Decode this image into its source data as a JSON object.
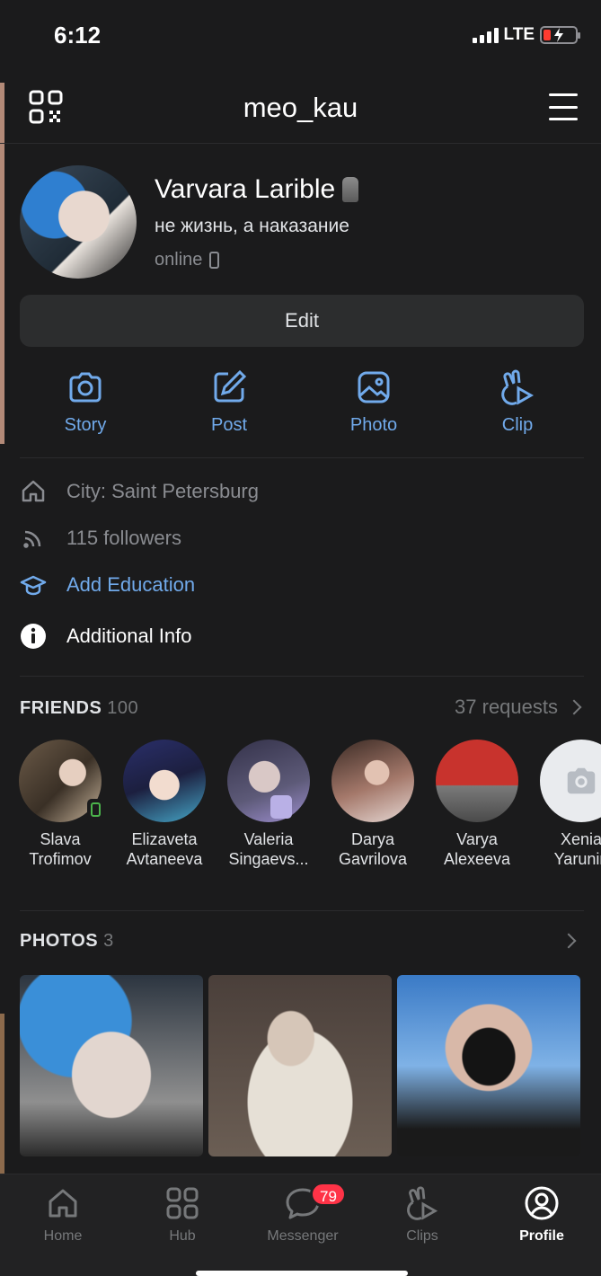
{
  "status_bar": {
    "time": "6:12",
    "network": "LTE"
  },
  "header": {
    "title": "meo_kau"
  },
  "profile": {
    "name": "Varvara Larible",
    "status": "не жизнь, а наказание",
    "online": "online",
    "edit_label": "Edit"
  },
  "actions": [
    {
      "label": "Story",
      "icon": "camera-icon"
    },
    {
      "label": "Post",
      "icon": "edit-square-icon"
    },
    {
      "label": "Photo",
      "icon": "image-icon"
    },
    {
      "label": "Clip",
      "icon": "clip-icon"
    }
  ],
  "info": {
    "city": "City: Saint Petersburg",
    "followers": "115 followers",
    "add_education": "Add Education",
    "additional_info": "Additional Info"
  },
  "friends": {
    "title": "FRIENDS",
    "count": "100",
    "requests": "37 requests",
    "items": [
      {
        "name": "Slava\nTrofimov"
      },
      {
        "name": "Elizaveta\nAvtaneeva"
      },
      {
        "name": "Valeria\nSingaevs..."
      },
      {
        "name": "Darya\nGavrilova"
      },
      {
        "name": "Varya\nAlexeeva"
      },
      {
        "name": "Xenia\nYarunin"
      }
    ]
  },
  "photos": {
    "title": "PHOTOS",
    "count": "3"
  },
  "tabbar": {
    "items": [
      {
        "label": "Home",
        "icon": "home-icon"
      },
      {
        "label": "Hub",
        "icon": "grid-icon"
      },
      {
        "label": "Messenger",
        "icon": "chat-icon",
        "badge": "79"
      },
      {
        "label": "Clips",
        "icon": "clip-icon"
      },
      {
        "label": "Profile",
        "icon": "profile-icon"
      }
    ]
  },
  "colors": {
    "accent": "#71aaeb",
    "background": "#1b1b1c",
    "badge": "#ff3347",
    "online": "#4bb34b"
  }
}
